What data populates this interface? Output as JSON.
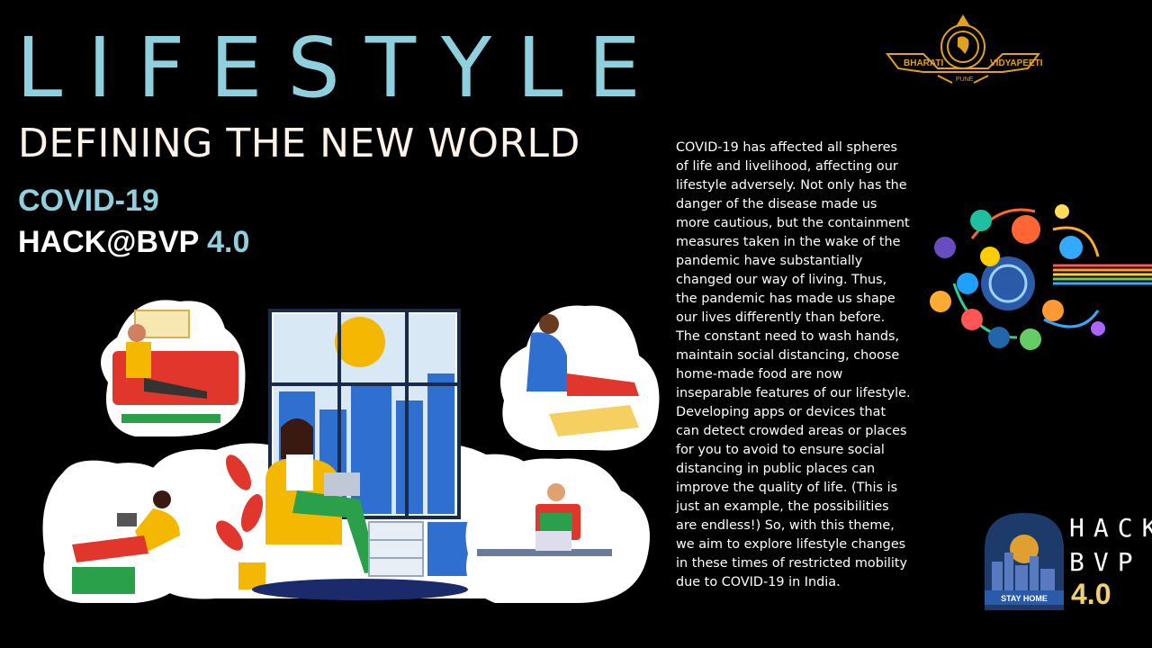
{
  "header": {
    "title": "LIFESTYLE",
    "subtitle": "DEFINING THE NEW WORLD",
    "theme": "COVID-19",
    "event_name": "HACK@BVP",
    "event_version": "4.0"
  },
  "description": "COVID-19 has affected all spheres of life and livelihood, affecting our lifestyle adversely. Not only has the danger of the disease made us more cautious, but the containment measures taken in the wake of the pandemic have substantially changed our way of living. Thus, the pandemic has made us shape our lives differently than before. The constant need to wash hands, maintain social distancing, choose home-made food are now inseparable features of our lifestyle. Developing apps or devices that can detect crowded areas or places for you to avoid to ensure social distancing in public places can improve the quality of life. (This is just an example, the possibilities are endless!) So, with this theme, we aim to explore lifestyle changes in these times of restricted mobility due to COVID-19 in India.",
  "bvp_logo": {
    "left_text": "BHARATI",
    "right_text": "VIDYAPEETH",
    "bottom_text": "PUNE",
    "seal_text": "BHARATI VIDYAPEETH"
  },
  "hackbvp_logo": {
    "line1": "HACK",
    "line2": "BVP",
    "version": "4.0",
    "badge": "STAY HOME"
  },
  "colors": {
    "accent": "#8fd0df",
    "subtitle": "#fff2e8",
    "logo_gold": "#e0a020",
    "background": "#000000"
  }
}
